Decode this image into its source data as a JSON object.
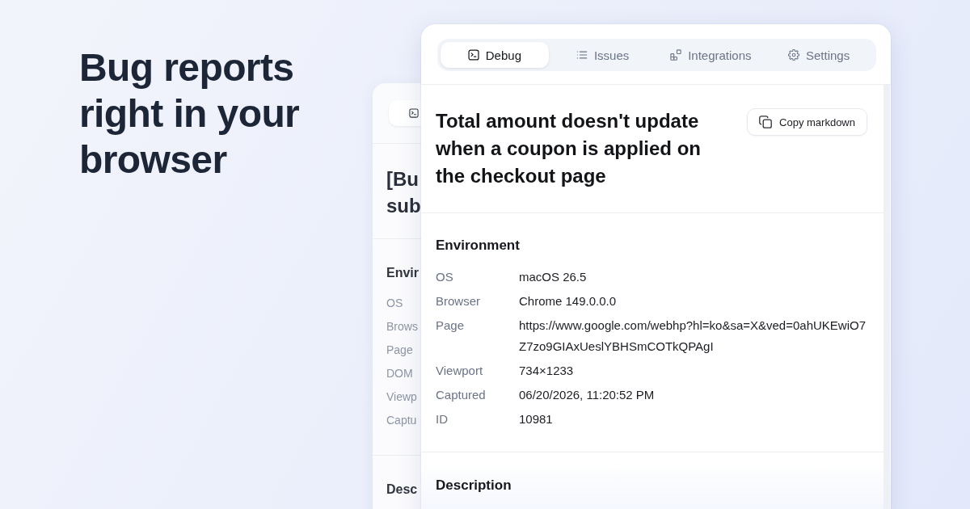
{
  "headline": "Bug reports right in your browser",
  "back_window": {
    "title_fragments": [
      "[Bu",
      "sub"
    ],
    "sections": [
      {
        "heading": "Envir",
        "labels": [
          "OS",
          "Brows",
          "Page",
          "DOM",
          "Viewp",
          "Captu"
        ]
      },
      {
        "heading": "Desc"
      }
    ]
  },
  "window": {
    "tabs": [
      {
        "label": "Debug",
        "selected": true
      },
      {
        "label": "Issues",
        "selected": false
      },
      {
        "label": "Integrations",
        "selected": false
      },
      {
        "label": "Settings",
        "selected": false
      }
    ],
    "title": "Total amount doesn't update when a coupon is applied on the checkout page",
    "copy_button": "Copy markdown",
    "sections": [
      {
        "heading": "Environment",
        "rows": [
          {
            "label": "OS",
            "value": "macOS 26.5"
          },
          {
            "label": "Browser",
            "value": "Chrome 149.0.0.0"
          },
          {
            "label": "Page",
            "value": "https://www.google.com/webhp?hl=ko&sa=X&ved=0ahUKEwiO7Z7zo9GIAxUeslYBHSmCOTkQPAgI"
          },
          {
            "label": "Viewport",
            "value": "734×1233"
          },
          {
            "label": "Captured",
            "value": "06/20/2026, 11:20:52 PM"
          },
          {
            "label": "ID",
            "value": "10981"
          }
        ]
      },
      {
        "heading": "Description"
      }
    ]
  }
}
